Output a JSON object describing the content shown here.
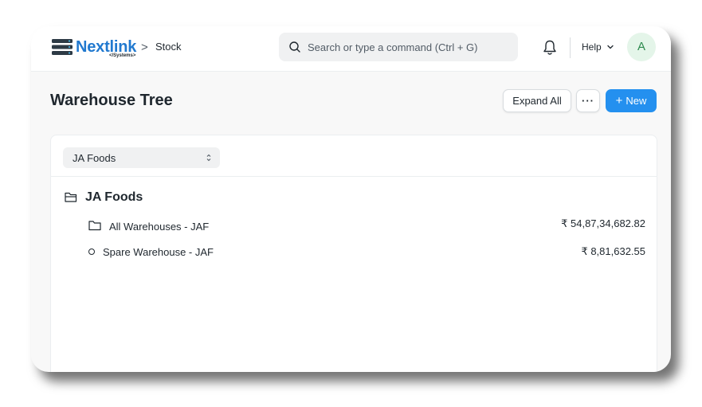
{
  "brand": {
    "name": "Nextlink",
    "sub": "</Systems>",
    "color": "#2179cf"
  },
  "breadcrumb": {
    "separator": ">",
    "items": [
      "Stock"
    ]
  },
  "search": {
    "placeholder": "Search or type a command (Ctrl + G)"
  },
  "navbar": {
    "help_label": "Help",
    "avatar_initial": "A",
    "notifications_icon": "bell-icon"
  },
  "page": {
    "title": "Warehouse Tree",
    "actions": {
      "expand_all": "Expand All",
      "more": "···",
      "new_icon": "+",
      "new": "New"
    }
  },
  "filter": {
    "company": "JA Foods"
  },
  "tree": {
    "root": {
      "label": "JA Foods",
      "icon": "folder-open-icon"
    },
    "children": [
      {
        "label": "All Warehouses - JAF",
        "value": "₹ 54,87,34,682.82",
        "icon": "folder-icon"
      },
      {
        "label": "Spare Warehouse - JAF",
        "value": "₹ 8,81,632.55",
        "icon": "leaf-node-icon"
      }
    ]
  },
  "colors": {
    "primary": "#2490ef",
    "text": "#1f272e",
    "avatar_bg": "#e4f5e9"
  }
}
